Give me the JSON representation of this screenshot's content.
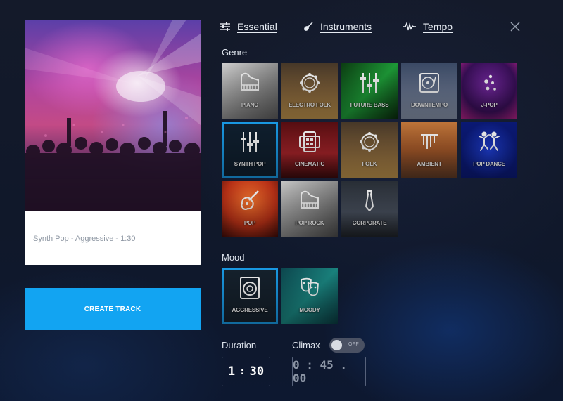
{
  "tabs": [
    {
      "label": "Essential",
      "icon": "sliders-icon"
    },
    {
      "label": "Instruments",
      "icon": "guitar-icon"
    },
    {
      "label": "Tempo",
      "icon": "waveform-icon"
    }
  ],
  "preview": {
    "caption": "Synth Pop - Aggressive - 1:30"
  },
  "create_button": {
    "label": "CREATE TRACK"
  },
  "genre": {
    "label": "Genre",
    "items": [
      {
        "label": "PIANO",
        "icon": "piano-icon"
      },
      {
        "label": "ELECTRO FOLK",
        "icon": "tambourine-icon"
      },
      {
        "label": "FUTURE BASS",
        "icon": "faders-icon"
      },
      {
        "label": "DOWNTEMPO",
        "icon": "turntable-icon"
      },
      {
        "label": "J-POP",
        "icon": "dots-icon"
      },
      {
        "label": "SYNTH POP",
        "icon": "faders-icon",
        "selected": true
      },
      {
        "label": "CINEMATIC",
        "icon": "film-reel-icon"
      },
      {
        "label": "FOLK",
        "icon": "tambourine-icon"
      },
      {
        "label": "AMBIENT",
        "icon": "wind-chimes-icon"
      },
      {
        "label": "POP DANCE",
        "icon": "dancers-icon"
      },
      {
        "label": "POP",
        "icon": "guitar-icon"
      },
      {
        "label": "POP ROCK",
        "icon": "piano-icon"
      },
      {
        "label": "CORPORATE",
        "icon": "tie-icon"
      }
    ]
  },
  "mood": {
    "label": "Mood",
    "items": [
      {
        "label": "AGGRESSIVE",
        "icon": "speaker-icon",
        "selected": true
      },
      {
        "label": "MOODY",
        "icon": "theater-masks-icon"
      }
    ]
  },
  "duration": {
    "label": "Duration",
    "minutes": "1",
    "separator": ":",
    "seconds": "30"
  },
  "climax": {
    "label": "Climax",
    "toggle_text": "OFF",
    "enabled": false,
    "time": "0 : 45 . 00"
  },
  "colors": {
    "accent": "#12a4f2",
    "selected_outline": "#1aa0ee",
    "background": "#141a2a"
  }
}
